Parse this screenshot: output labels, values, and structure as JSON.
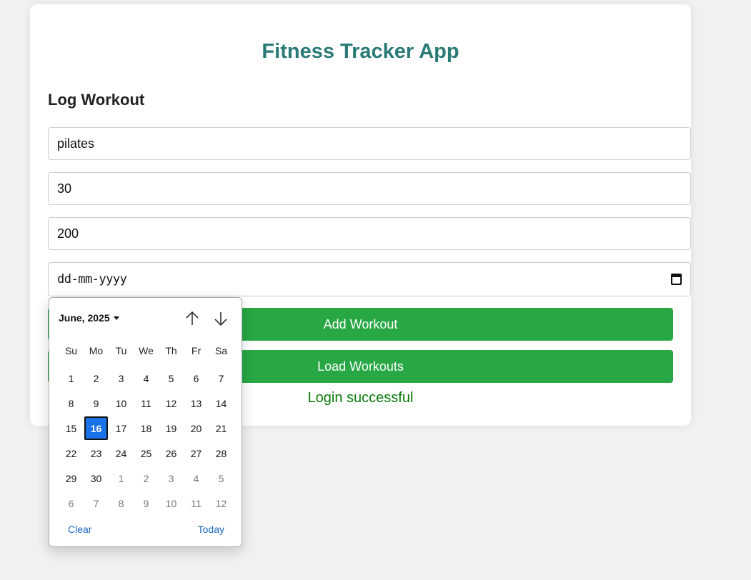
{
  "app": {
    "title": "Fitness Tracker App"
  },
  "form": {
    "section_title": "Log Workout",
    "fields": [
      {
        "value": "pilates"
      },
      {
        "value": "30"
      },
      {
        "value": "200"
      }
    ],
    "date_placeholder": "dd-mm-yyyy"
  },
  "buttons": {
    "add": "Add Workout",
    "load": "Load Workouts"
  },
  "status": {
    "message": "Login successful",
    "color": "#0a7a0a"
  },
  "datepicker": {
    "month_label": "June, 2025",
    "weekdays": [
      "Su",
      "Mo",
      "Tu",
      "We",
      "Th",
      "Fr",
      "Sa"
    ],
    "selected_day": "16",
    "weeks": [
      [
        {
          "d": "1"
        },
        {
          "d": "2"
        },
        {
          "d": "3"
        },
        {
          "d": "4"
        },
        {
          "d": "5"
        },
        {
          "d": "6"
        },
        {
          "d": "7"
        }
      ],
      [
        {
          "d": "8"
        },
        {
          "d": "9"
        },
        {
          "d": "10"
        },
        {
          "d": "11"
        },
        {
          "d": "12"
        },
        {
          "d": "13"
        },
        {
          "d": "14"
        }
      ],
      [
        {
          "d": "15"
        },
        {
          "d": "16",
          "selected": true
        },
        {
          "d": "17"
        },
        {
          "d": "18"
        },
        {
          "d": "19"
        },
        {
          "d": "20"
        },
        {
          "d": "21"
        }
      ],
      [
        {
          "d": "22"
        },
        {
          "d": "23"
        },
        {
          "d": "24"
        },
        {
          "d": "25"
        },
        {
          "d": "26"
        },
        {
          "d": "27"
        },
        {
          "d": "28"
        }
      ],
      [
        {
          "d": "29"
        },
        {
          "d": "30"
        },
        {
          "d": "1",
          "other": true
        },
        {
          "d": "2",
          "other": true
        },
        {
          "d": "3",
          "other": true
        },
        {
          "d": "4",
          "other": true
        },
        {
          "d": "5",
          "other": true
        }
      ],
      [
        {
          "d": "6",
          "other": true
        },
        {
          "d": "7",
          "other": true
        },
        {
          "d": "8",
          "other": true
        },
        {
          "d": "9",
          "other": true
        },
        {
          "d": "10",
          "other": true
        },
        {
          "d": "11",
          "other": true
        },
        {
          "d": "12",
          "other": true
        }
      ]
    ],
    "clear_label": "Clear",
    "today_label": "Today"
  },
  "colors": {
    "accent": "#2a7a78",
    "button": "#28a745",
    "selected": "#1a73e8",
    "link": "#1a66c0"
  },
  "icons": {
    "date_field": "calendar-icon",
    "prev_month": "arrow-up-icon",
    "next_month": "arrow-down-icon",
    "month_menu": "caret-down-icon"
  }
}
